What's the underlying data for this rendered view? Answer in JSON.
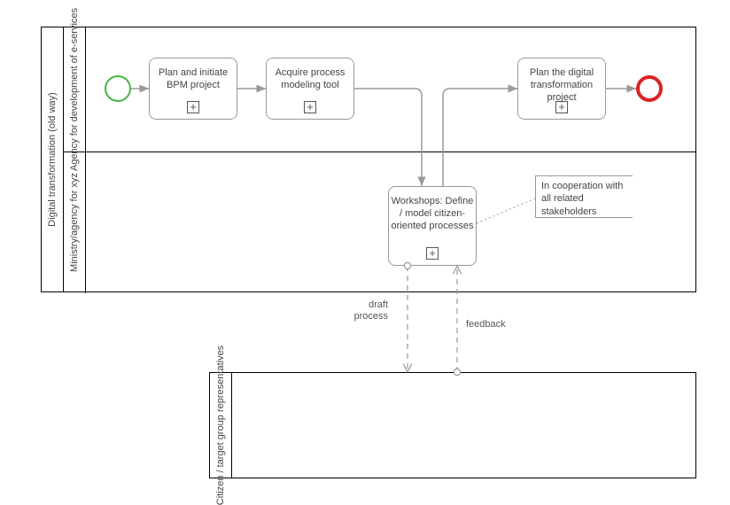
{
  "pool1": {
    "title": "Digital transformation (old way)",
    "lanes": {
      "top": "Agency for development of e-services",
      "bottom": "Ministry/agency for xyz"
    }
  },
  "pool2": {
    "title": "Citizen / target group representatives"
  },
  "tasks": {
    "t1": "Plan and initiate BPM project",
    "t2": "Acquire process modeling tool",
    "t3": "Workshops: Define / model citizen-oriented processes",
    "t4": "Plan the digital transformation project"
  },
  "annotation": "In cooperation with all related stakeholders",
  "msg": {
    "draft": "draft process",
    "feedback": "feedback"
  },
  "expand_glyph": "+"
}
